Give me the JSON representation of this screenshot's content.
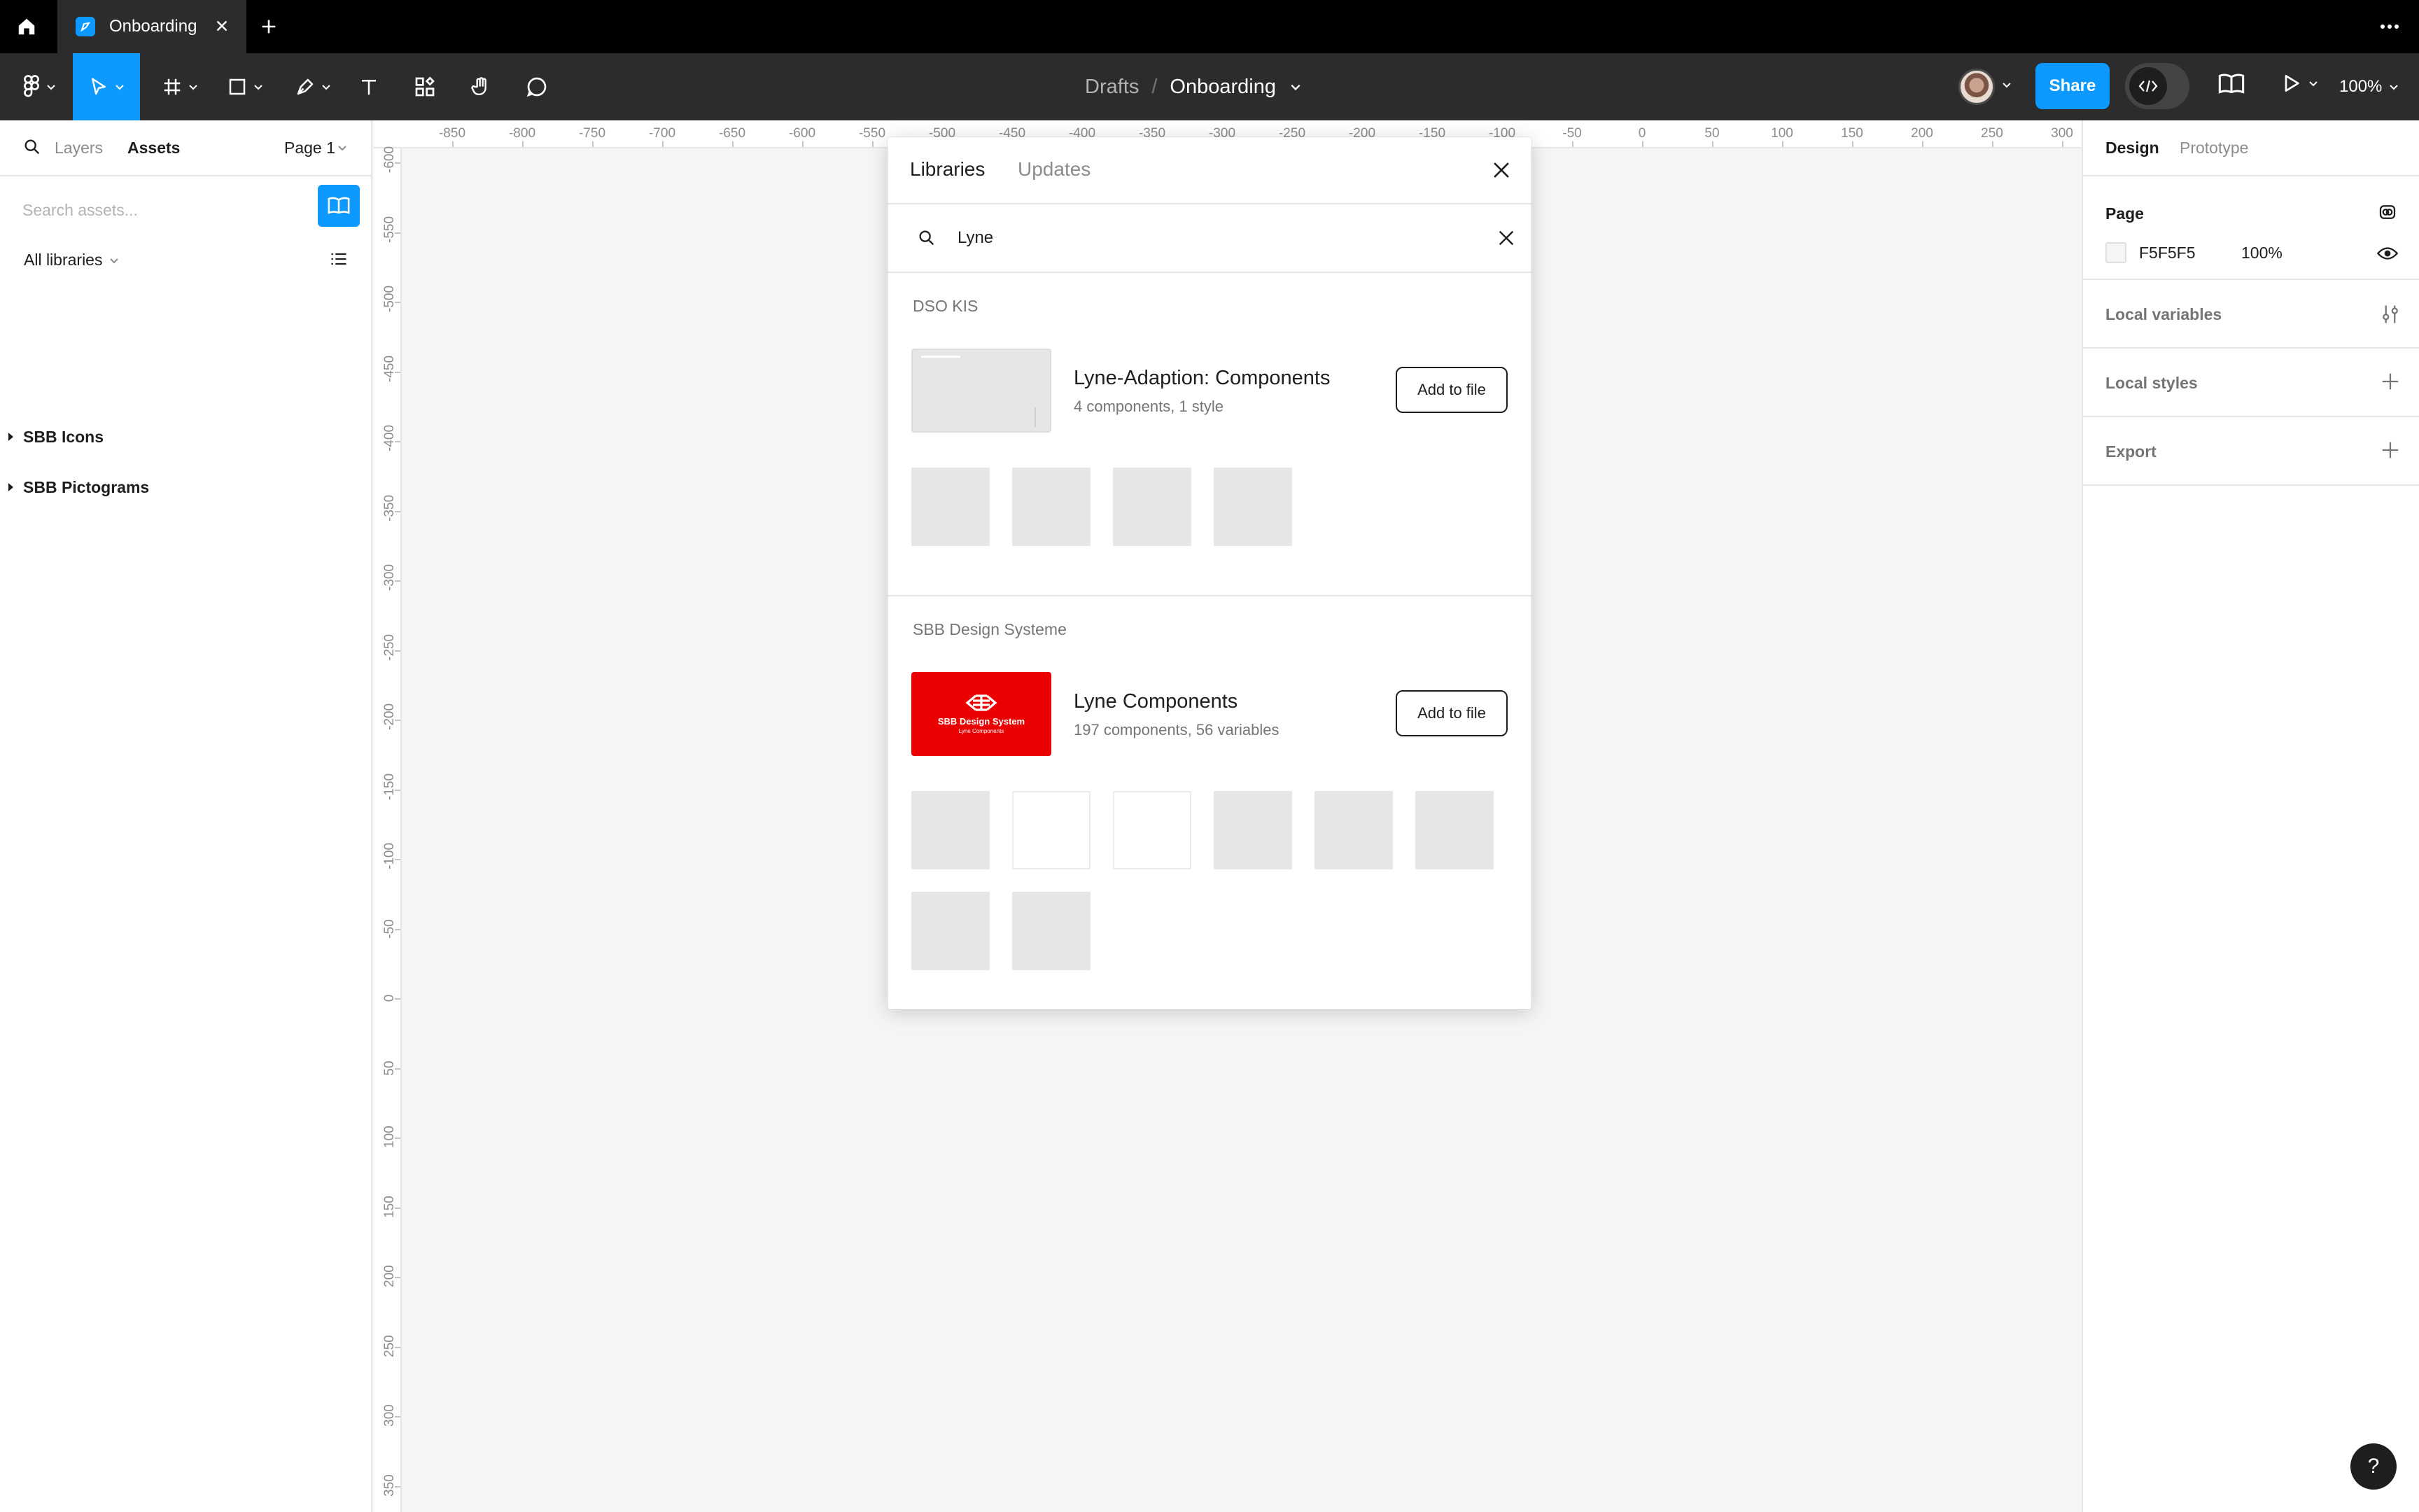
{
  "tab": {
    "title": "Onboarding"
  },
  "toolbar": {
    "breadcrumb_parent": "Drafts",
    "breadcrumb_separator": "/",
    "file_name": "Onboarding",
    "share_label": "Share",
    "zoom": "100%"
  },
  "left_panel": {
    "tab_layers": "Layers",
    "tab_assets": "Assets",
    "page_selector": "Page 1",
    "search_placeholder": "Search assets...",
    "library_filter": "All libraries",
    "libraries": [
      {
        "label": "SBB Icons"
      },
      {
        "label": "SBB Pictograms"
      }
    ]
  },
  "rulers": {
    "top": [
      "-850",
      "-800",
      "-750",
      "-700",
      "-650",
      "-600",
      "-550",
      "-500",
      "-450",
      "-400",
      "-350",
      "-300",
      "-250",
      "-200",
      "-150",
      "-100",
      "-50",
      "0",
      "50",
      "100",
      "150",
      "200",
      "250",
      "300"
    ],
    "left": [
      "-600",
      "-550",
      "-500",
      "-450",
      "-400",
      "-350",
      "-300",
      "-250",
      "-200",
      "-150",
      "-100",
      "-50",
      "0",
      "50",
      "100",
      "150",
      "200",
      "250",
      "300",
      "350"
    ]
  },
  "right_panel": {
    "tab_design": "Design",
    "tab_prototype": "Prototype",
    "page_title": "Page",
    "page_color": "F5F5F5",
    "page_opacity": "100%",
    "local_variables": "Local variables",
    "local_styles": "Local styles",
    "export": "Export"
  },
  "modal": {
    "tab_libraries": "Libraries",
    "tab_updates": "Updates",
    "search_value": "Lyne",
    "groups": [
      {
        "label": "DSO KIS",
        "library_name": "Lyne-Adaption: Components",
        "library_meta": "4 components, 1 style",
        "add_label": "Add to file",
        "preview_count": 4
      },
      {
        "label": "SBB Design Systeme",
        "library_name": "Lyne Components",
        "library_meta": "197 components, 56 variables",
        "add_label": "Add to file",
        "thumb_brand": "SBB Design System",
        "thumb_sub": "Lyne Components",
        "preview_count": 8
      }
    ]
  },
  "colors": {
    "accent": "#0d99ff",
    "brand_red": "#eb0000",
    "toolbar_bg": "#2c2c2c",
    "tabbar_bg": "#000000",
    "canvas_bg": "#f5f5f5"
  },
  "help_label": "?"
}
